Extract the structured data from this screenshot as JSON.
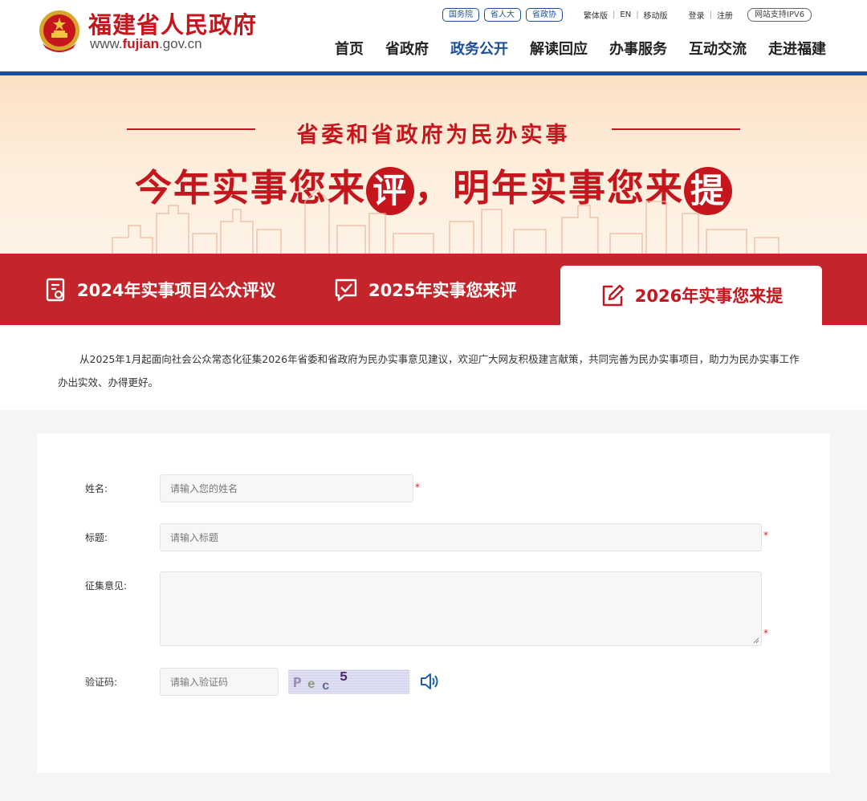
{
  "header": {
    "site_title": "福建省人民政府",
    "site_url_prefix": "www.",
    "site_url_domain": "fujian",
    "site_url_suffix": ".gov.cn",
    "pills": [
      "国务院",
      "省人大",
      "省政协"
    ],
    "links": [
      "繁体版",
      "EN",
      "移动版"
    ],
    "auth": [
      "登录",
      "注册"
    ],
    "ipv6": "网站支持IPV6",
    "nav": [
      "首页",
      "省政府",
      "政务公开",
      "解读回应",
      "办事服务",
      "互动交流",
      "走进福建"
    ],
    "nav_active_index": 2
  },
  "banner": {
    "subtitle": "省委和省政府为民办实事",
    "main_part1": "今年实事您来",
    "main_circle1": "评",
    "main_part2": "，明年实事您来",
    "main_circle2": "提"
  },
  "tabs": [
    {
      "label": "2024年实事项目公众评议",
      "icon": "document-eye-icon"
    },
    {
      "label": "2025年实事您来评",
      "icon": "chat-check-icon"
    },
    {
      "label": "2026年实事您来提",
      "icon": "edit-icon",
      "active": true
    }
  ],
  "intro": "从2025年1月起面向社会公众常态化征集2026年省委和省政府为民办实事意见建议，欢迎广大网友积极建言献策，共同完善为民办实事项目，助力为民办实事工作办出实效、办得更好。",
  "form": {
    "name_label": "姓名:",
    "name_placeholder": "请输入您的姓名",
    "title_label": "标题:",
    "title_placeholder": "请输入标题",
    "opinion_label": "征集意见:",
    "captcha_label": "验证码:",
    "captcha_placeholder": "请输入验证码",
    "captcha_chars": [
      "P",
      "e",
      "c",
      "5"
    ],
    "required_mark": "*"
  },
  "colors": {
    "brand_red": "#c4161c",
    "nav_blue": "#1b4f98",
    "tab_bar_red": "#c4252a"
  }
}
